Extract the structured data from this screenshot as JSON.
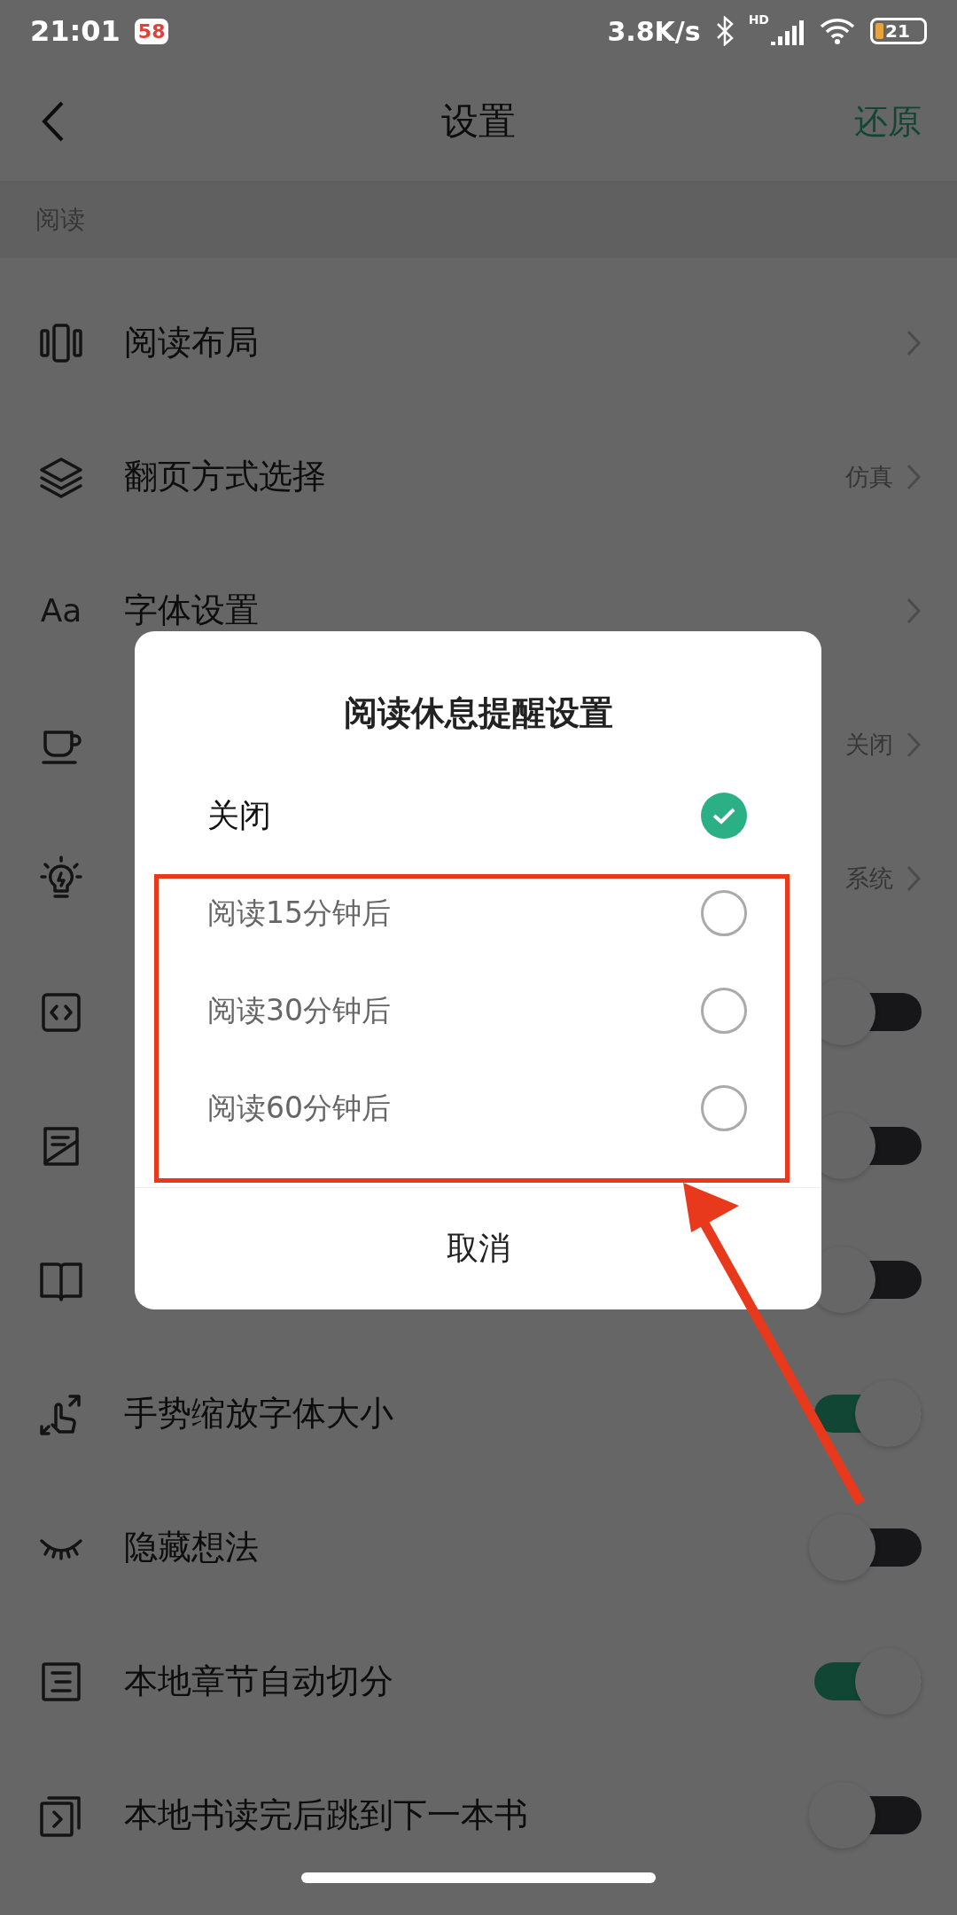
{
  "status_bar": {
    "time": "21:01",
    "app_badge": "58",
    "network_speed": "3.8K/s",
    "signal_label": "HD",
    "battery": "21"
  },
  "nav": {
    "title": "设置",
    "action": "还原"
  },
  "section": "阅读",
  "rows": [
    {
      "kind": "link",
      "label": "阅读布局"
    },
    {
      "kind": "link",
      "label": "翻页方式选择",
      "value": "仿真"
    },
    {
      "kind": "link",
      "label": "字体设置",
      "icon_text": "Aa"
    },
    {
      "kind": "link",
      "value": "关闭"
    },
    {
      "kind": "link",
      "value": "系统"
    },
    {
      "kind": "toggle",
      "on": false
    },
    {
      "kind": "toggle",
      "on": false
    },
    {
      "kind": "toggle",
      "on": false
    },
    {
      "kind": "toggle",
      "label": "手势缩放字体大小",
      "on": true
    },
    {
      "kind": "toggle",
      "label": "隐藏想法",
      "on": false
    },
    {
      "kind": "toggle",
      "label": "本地章节自动切分",
      "on": true
    },
    {
      "kind": "toggle",
      "label": "本地书读完后跳到下一本书",
      "on": false
    }
  ],
  "dialog": {
    "title": "阅读休息提醒设置",
    "options": [
      {
        "label": "关闭",
        "selected": true
      },
      {
        "label": "阅读15分钟后",
        "selected": false
      },
      {
        "label": "阅读30分钟后",
        "selected": false
      },
      {
        "label": "阅读60分钟后",
        "selected": false
      }
    ],
    "cancel": "取消"
  },
  "annotations": {
    "highlight_box": true,
    "arrow": true
  }
}
